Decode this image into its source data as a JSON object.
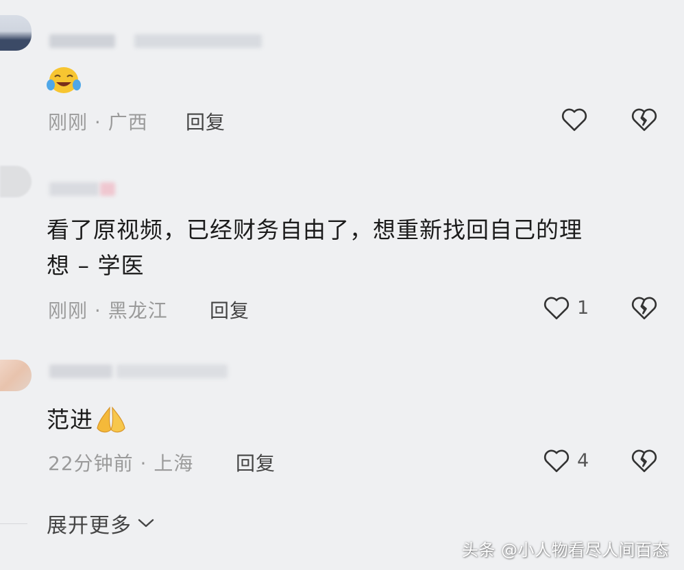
{
  "comments": [
    {
      "body": "",
      "emoji": "cry-laugh-emoji",
      "time": "刚刚",
      "separator": "·",
      "location": "广西",
      "reply_label": "回复",
      "like_count": ""
    },
    {
      "body_line1": "看了原视频，已经财务自由了，想重新找回自己的理",
      "body_line2": "想 – 学医",
      "time": "刚刚",
      "separator": "·",
      "location": "黑龙江",
      "reply_label": "回复",
      "like_count": "1"
    },
    {
      "body": "范进",
      "emoji": "folded-hands-emoji",
      "time": "22分钟前",
      "separator": "·",
      "location": "上海",
      "reply_label": "回复",
      "like_count": "4"
    }
  ],
  "expand_label": "展开更多",
  "watermark": "头条 @小人物看尽人间百态",
  "colors": {
    "background": "#eff0f2",
    "meta_text": "#9a9a9a",
    "body_text": "#1b1b1b"
  }
}
